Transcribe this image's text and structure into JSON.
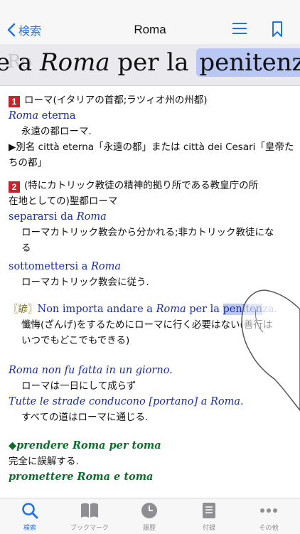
{
  "navbar": {
    "back_label": "検索",
    "title": "Roma"
  },
  "magnifier": {
    "prefix": "e a ",
    "roma": "Roma",
    "middle": " per la ",
    "highlight": "penitenza",
    "suffix": ".",
    "ghost": "Ro"
  },
  "entries": {
    "s1_label": "1",
    "s1_text": "ローマ(イタリアの首都;ラツィオ州の州都)",
    "e1_phrase": "Roma",
    "e1_rest": " eterna",
    "e1_tr": "永遠の都ローマ.",
    "e1_note1": "▶別名 città eterna「永遠の都」または città dei Cesari「皇帝た",
    "e1_note2": "ちの都」",
    "s2_label": "2",
    "s2_text1": "(特にカトリック教徒の精神的拠り所である教皇庁の所",
    "s2_text2": "在地としての)聖都ローマ",
    "e2_a": "separarsi da ",
    "e2_b": "Roma",
    "e2_tr1": "ローマカトリック教会から分かれる;非カトリック教徒にな",
    "e2_tr2": "る",
    "e3_a": "sottomettersi a ",
    "e3_b": "Roma",
    "e3_tr": "ローマカトリック教会に従う.",
    "pv_mark": "〖諺〗",
    "pv_a": "Non importa andare a ",
    "pv_b": "Roma",
    "pv_c": " per la ",
    "pv_hl": "peniten",
    "pv_d": "za.",
    "pv_tr1": "懺悔(ざんげ)をするためにローマに行く必要はない(善行は",
    "pv_tr2": "いつでもどこでもできる)",
    "e4_a": "Roma",
    "e4_b": " non fu fatta in un giorno.",
    "e4_tr": "ローマは一日にして成らず",
    "e5_a": "Tutte le strade conducono [portano] a ",
    "e5_b": "Roma",
    "e5_c": ".",
    "e5_tr": "すべての道はローマに通じる.",
    "ph1": "◆prendere Roma per toma",
    "ph1_tr": "完全に誤解する.",
    "ph2": "promettere Roma e toma"
  },
  "tabs": [
    {
      "label": "検索",
      "icon": "search-icon"
    },
    {
      "label": "ブックマーク",
      "icon": "book-icon"
    },
    {
      "label": "履歴",
      "icon": "clock-icon"
    },
    {
      "label": "付録",
      "icon": "appendix-icon"
    },
    {
      "label": "その他",
      "icon": "more-icon"
    }
  ],
  "colors": {
    "accent": "#1e74e6",
    "sense_red": "#c6242b",
    "example_blue": "#1a2ca8",
    "phrase_green": "#0b6f2b"
  }
}
